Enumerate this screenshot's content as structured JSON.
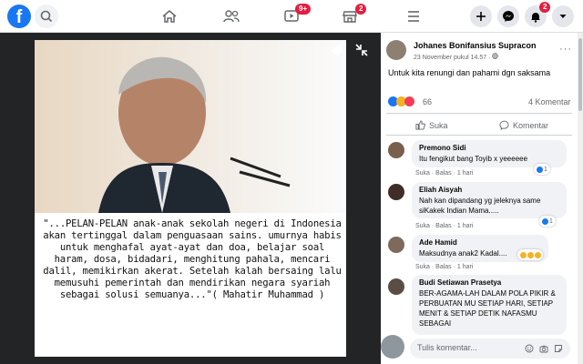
{
  "topbar": {
    "logo": "f",
    "nav_badges": {
      "watch": "9+",
      "marketplace": "2",
      "notifications": "2"
    }
  },
  "post": {
    "author": "Johanes Bonifansius Supracon",
    "time": "23 November pukul 14.57 · ",
    "caption": "Untuk kita renungi dan pahami dgn saksama",
    "reactions_count": "66",
    "comments_count": "4 Komentar",
    "like_label": "Suka",
    "comment_label": "Komentar",
    "image_quote": "\"...PELAN-PELAN anak-anak sekolah negeri di Indonesia akan tertinggal dalam penguasaan sains. umurnya habis untuk menghafal ayat-ayat dan doa, belajar soal haram, dosa, bidadari, menghitung pahala, mencari dalil, memikirkan akerat. Setelah kalah bersaing lalu memusuhi pemerintah dan mendirikan negara syariah sebagai solusi semuanya...\"( Mahatir Muhammad )"
  },
  "comments": [
    {
      "name": "Premono Sidi",
      "text": "Itu fengikut bang Toyib x yeeeeee",
      "actions": "Suka · Balas · 1 hari",
      "reaction_count": "1"
    },
    {
      "name": "Eliah Aisyah",
      "text": "Nah kan dipandang yg jeleknya same siKakek Indian Mama.....",
      "actions": "Suka · Balas · 1 hari",
      "reaction_count": "1"
    },
    {
      "name": "Ade Hamid",
      "text": "Maksudnya anak2 Kadal....",
      "actions": "Suka · Balas · 1 hari",
      "reaction_count": ""
    },
    {
      "name": "Budi Setiawan Prasetya",
      "text": "BER-AGAMA-LAH DALAM POLA PIKIR & PERBUATAN MU SETIAP HARI, SETIAP MENIT & SETIAP DETIK NAFASMU SEBAGAI",
      "actions": "",
      "reaction_count": ""
    }
  ],
  "composer": {
    "placeholder": "Tulis komentar..."
  },
  "colors": {
    "brand": "#1877f2",
    "badge": "#e41e3f"
  }
}
